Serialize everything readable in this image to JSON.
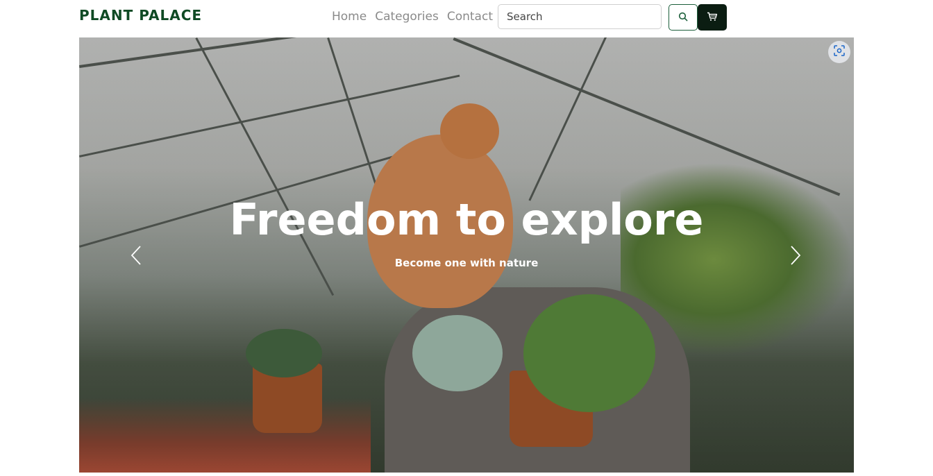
{
  "brand": {
    "name": "PLANT PALACE",
    "color": "#0f4a24"
  },
  "nav": {
    "links": [
      {
        "label": "Home"
      },
      {
        "label": "Categories"
      },
      {
        "label": "Contact"
      }
    ]
  },
  "search": {
    "placeholder": "Search",
    "button_icon": "search-icon"
  },
  "cart": {
    "button_icon": "cart-icon"
  },
  "hero": {
    "title": "Freedom to explore",
    "subtitle": "Become one with nature",
    "prev_icon": "chevron-left-icon",
    "next_icon": "chevron-right-icon",
    "lens_icon": "visual-search-icon"
  }
}
